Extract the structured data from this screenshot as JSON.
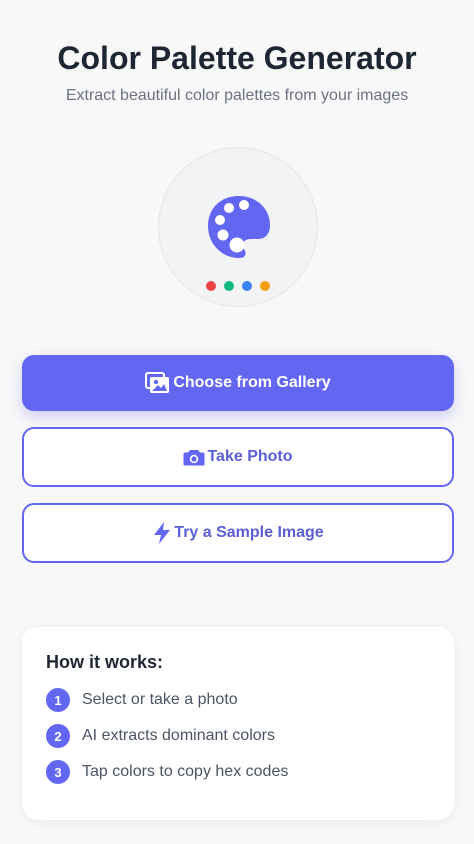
{
  "header": {
    "title": "Color Palette Generator",
    "subtitle": "Extract beautiful color palettes from your images"
  },
  "hero": {
    "icon": "palette-icon",
    "accent_color": "#6366f1",
    "swatch_dots": [
      "#ef4444",
      "#10b981",
      "#3b82f6",
      "#f59e0b"
    ]
  },
  "actions": {
    "gallery": {
      "label": "Choose from Gallery",
      "icon": "images-icon"
    },
    "camera": {
      "label": "Take Photo",
      "icon": "camera-icon"
    },
    "sample": {
      "label": "Try a Sample Image",
      "icon": "lightning-icon"
    }
  },
  "how_it_works": {
    "title": "How it works:",
    "steps": [
      {
        "num": "1",
        "text": "Select or take a photo"
      },
      {
        "num": "2",
        "text": "AI extracts dominant colors"
      },
      {
        "num": "3",
        "text": "Tap colors to copy hex codes"
      }
    ]
  },
  "colors": {
    "primary": "#6366f1",
    "background": "#f8f8f8",
    "text_dark": "#1f2633",
    "text_muted": "#6b7280"
  }
}
